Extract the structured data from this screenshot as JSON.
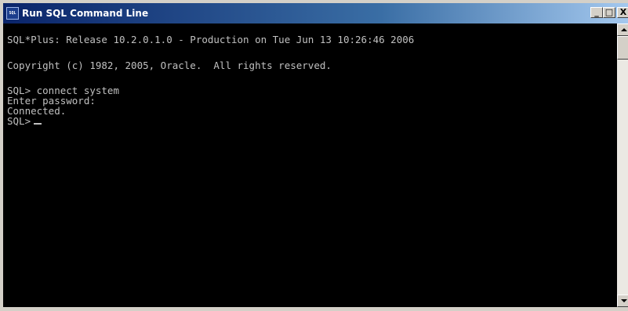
{
  "window": {
    "title": "Run SQL Command Line",
    "icon": "sql-app-icon",
    "icon_text": "SQL",
    "buttons": {
      "minimize": "_",
      "maximize": "□",
      "close": "X"
    }
  },
  "console": {
    "lines": [
      "SQL*Plus: Release 10.2.0.1.0 - Production on Tue Jun 13 10:26:46 2006",
      "Copyright (c) 1982, 2005, Oracle.  All rights reserved.",
      "SQL> connect system",
      "Enter password:",
      "Connected.",
      "SQL>"
    ],
    "text_color": "#c0c0c0",
    "background": "#000000"
  },
  "colors": {
    "titlebar_start": "#0a246a",
    "titlebar_end": "#a6caf0",
    "chrome": "#d4d0c8"
  }
}
